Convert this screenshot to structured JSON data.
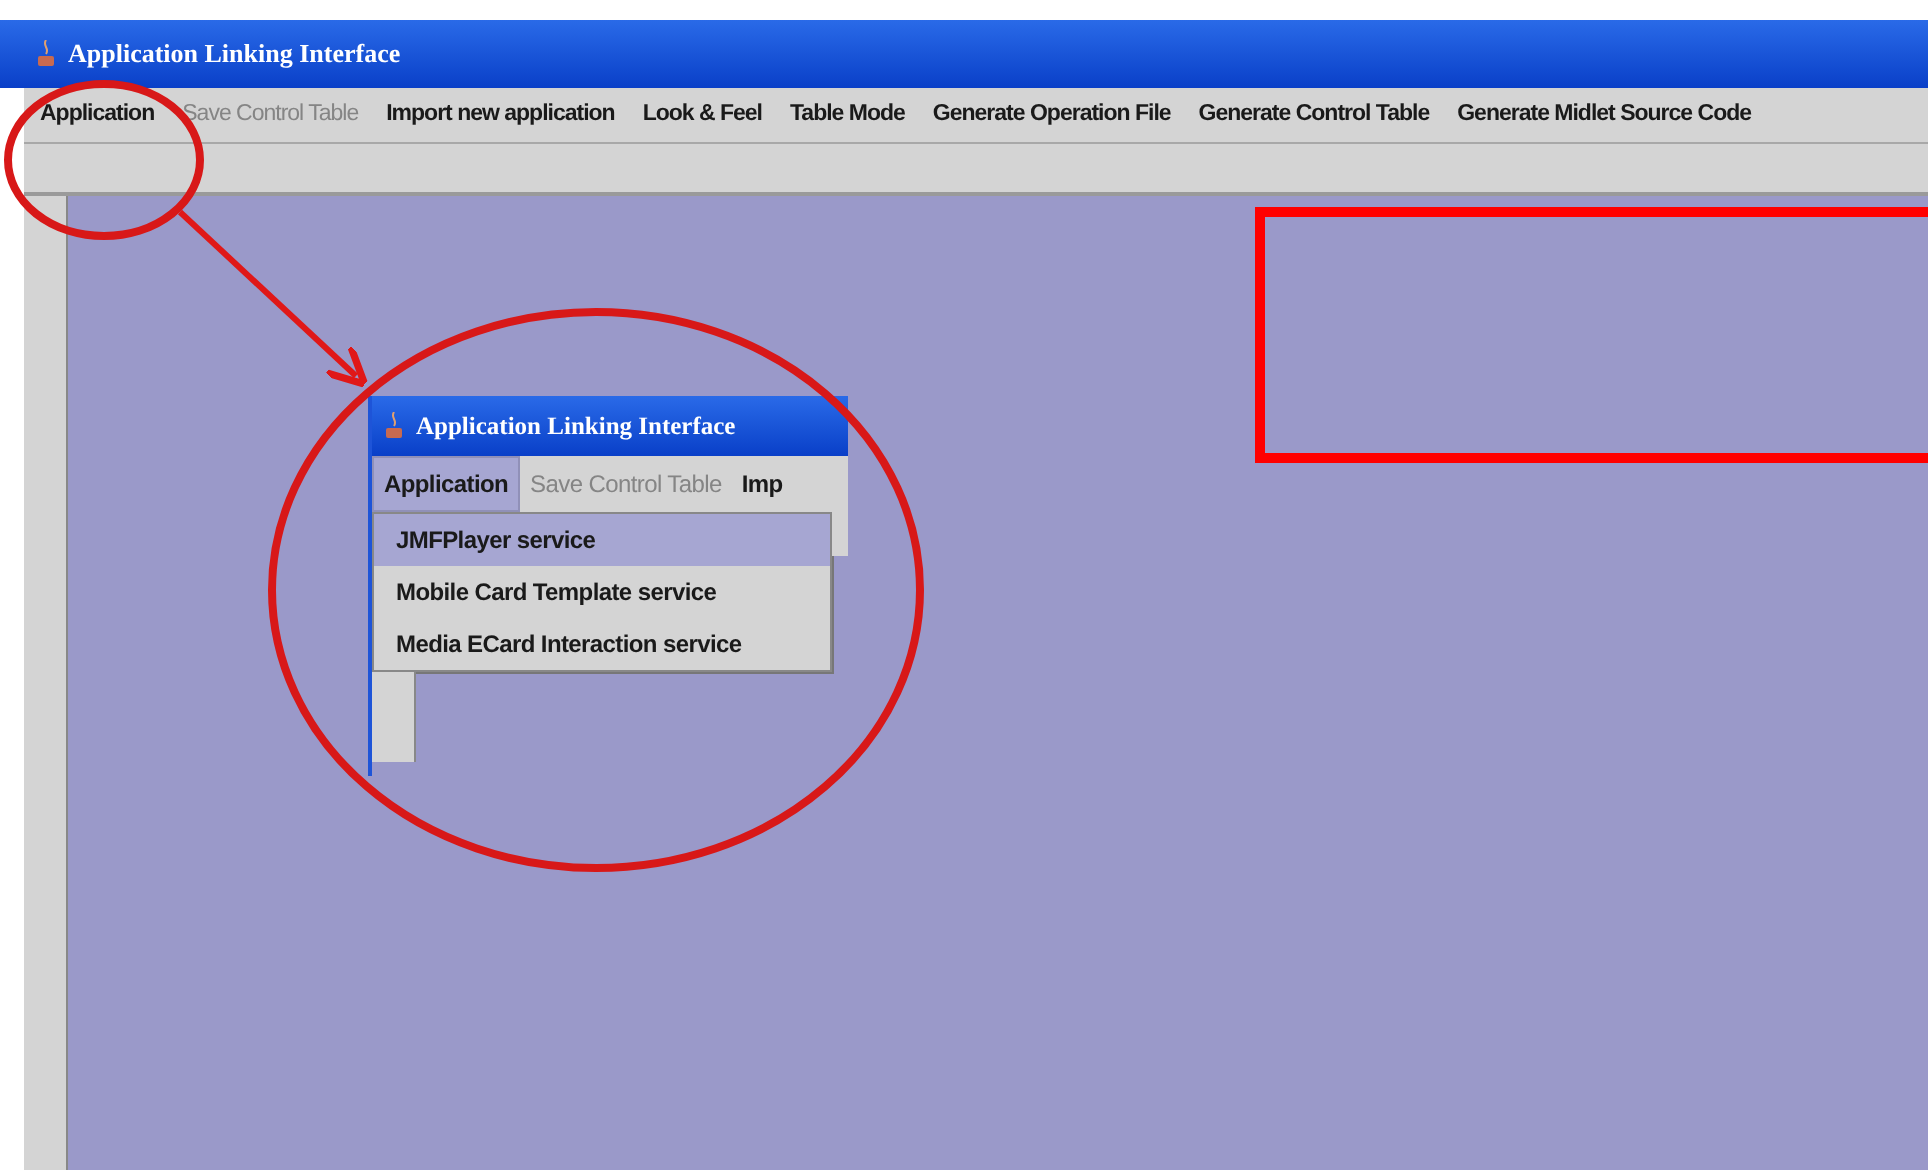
{
  "window": {
    "title": "Application Linking Interface"
  },
  "menu_bar": [
    {
      "label": "Application",
      "disabled": false
    },
    {
      "label": "Save Control Table",
      "disabled": true
    },
    {
      "label": "Import new application",
      "disabled": false
    },
    {
      "label": "Look & Feel",
      "disabled": false
    },
    {
      "label": "Table Mode",
      "disabled": false
    },
    {
      "label": "Generate Operation File",
      "disabled": false
    },
    {
      "label": "Generate Control Table",
      "disabled": false
    },
    {
      "label": "Generate Midlet Source Code",
      "disabled": false
    }
  ],
  "inset_window": {
    "title": "Application Linking Interface",
    "menu_bar": [
      {
        "label": "Application",
        "selected": true,
        "disabled": false
      },
      {
        "label": "Save Control Table",
        "selected": false,
        "disabled": true
      },
      {
        "label": "Imp",
        "selected": false,
        "disabled": false
      }
    ],
    "menu_items": [
      {
        "label": "JMFPlayer service",
        "selected": true
      },
      {
        "label": "Mobile Card Template service",
        "selected": false
      },
      {
        "label": "Media ECard Interaction service",
        "selected": false
      }
    ]
  }
}
